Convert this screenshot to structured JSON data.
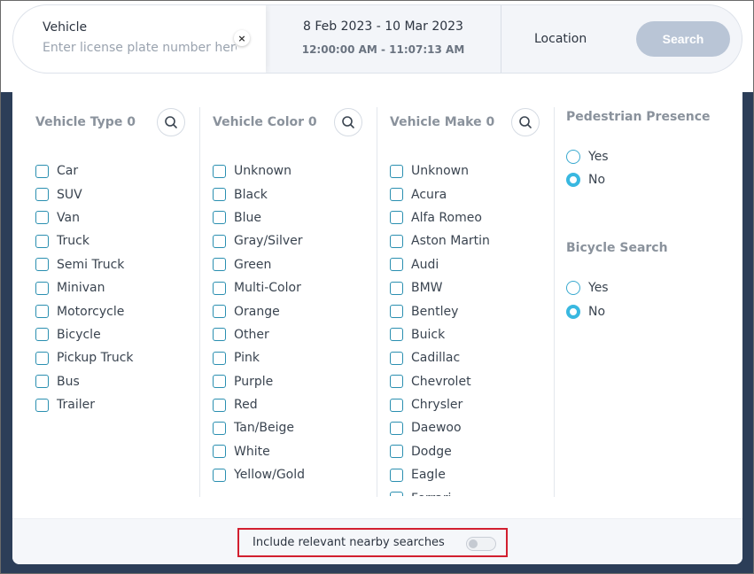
{
  "search_bar": {
    "vehicle_label": "Vehicle",
    "plate_placeholder": "Enter license plate number here",
    "plate_value": "",
    "clear_label": "×",
    "date_range": "8 Feb 2023 - 10 Mar 2023",
    "time_range": "12:00:00 AM - 11:07:13 AM",
    "location_label": "Location",
    "search_button": "Search"
  },
  "filters": {
    "vehicle_type": {
      "title": "Vehicle Type 0",
      "options": [
        "Car",
        "SUV",
        "Van",
        "Truck",
        "Semi Truck",
        "Minivan",
        "Motorcycle",
        "Bicycle",
        "Pickup Truck",
        "Bus",
        "Trailer"
      ]
    },
    "vehicle_color": {
      "title": "Vehicle Color 0",
      "options": [
        "Unknown",
        "Black",
        "Blue",
        "Gray/Silver",
        "Green",
        "Multi-Color",
        "Orange",
        "Other",
        "Pink",
        "Purple",
        "Red",
        "Tan/Beige",
        "White",
        "Yellow/Gold"
      ]
    },
    "vehicle_make": {
      "title": "Vehicle Make 0",
      "options": [
        "Unknown",
        "Acura",
        "Alfa Romeo",
        "Aston Martin",
        "Audi",
        "BMW",
        "Bentley",
        "Buick",
        "Cadillac",
        "Chevrolet",
        "Chrysler",
        "Daewoo",
        "Dodge",
        "Eagle",
        "Ferrari"
      ]
    },
    "pedestrian_presence": {
      "title": "Pedestrian Presence",
      "options": [
        "Yes",
        "No"
      ],
      "selected": "No"
    },
    "bicycle_search": {
      "title": "Bicycle Search",
      "options": [
        "Yes",
        "No"
      ],
      "selected": "No"
    }
  },
  "footer": {
    "nearby_label": "Include relevant nearby searches",
    "nearby_enabled": false
  },
  "colors": {
    "checkbox_border": "#2a8fb0",
    "radio_selected": "#39b8e0",
    "search_button_bg": "#b9c5d6",
    "highlight_border": "#d21f2f",
    "backdrop": "#2c3e58"
  },
  "icons": {
    "column_search": "search-icon",
    "clear": "close-icon"
  }
}
